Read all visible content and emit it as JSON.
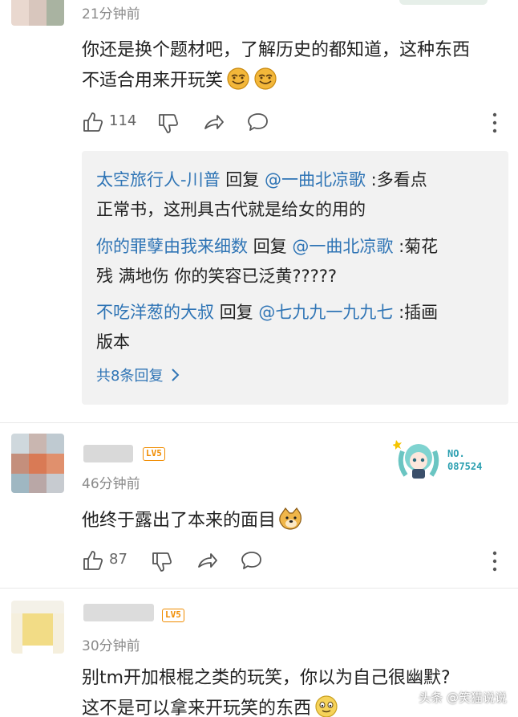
{
  "comment1": {
    "time": "21分钟前",
    "text_lines": [
      "你还是换个题材吧，了解历史的都知道，这种东西",
      "不适合用来开玩笑"
    ],
    "likes": "114",
    "emojis": [
      "grin-emoji",
      "grin-emoji"
    ],
    "replies": [
      {
        "user": "太空旅行人-川普",
        "verb": "回复",
        "target": "@一曲北凉歌",
        "lines_rest": [
          ":多看点",
          "正常书，这刑具古代就是给女的用的"
        ]
      },
      {
        "user": "你的罪孽由我来细数",
        "verb": "回复",
        "target": "@一曲北凉歌",
        "lines_rest": [
          ":菊花",
          "残 满地伤 你的笑容已泛黄?????"
        ]
      },
      {
        "user": "不吃洋葱的大叔",
        "verb": "回复",
        "target": "@七九九一九九七",
        "lines_rest": [
          ":插画",
          "版本"
        ]
      }
    ],
    "more_replies": "共8条回复"
  },
  "comment2": {
    "badge": "LV5",
    "time": "46分钟前",
    "text": "他终于露出了本来的面目",
    "likes": "87",
    "medal_no": "NO.",
    "medal_id": "087524"
  },
  "comment3": {
    "badge": "LV5",
    "time": "30分钟前",
    "text_lines": [
      "别tm开加根棍之类的玩笑，你以为自己很幽默?",
      "这不是可以拿来开玩笑的东西"
    ]
  },
  "watermark": "头条 @笑猫说说",
  "colors": {
    "link_blue": "#2e74b5",
    "badge_orange": "#f08c00",
    "reply_bg": "#f2f2f2"
  }
}
